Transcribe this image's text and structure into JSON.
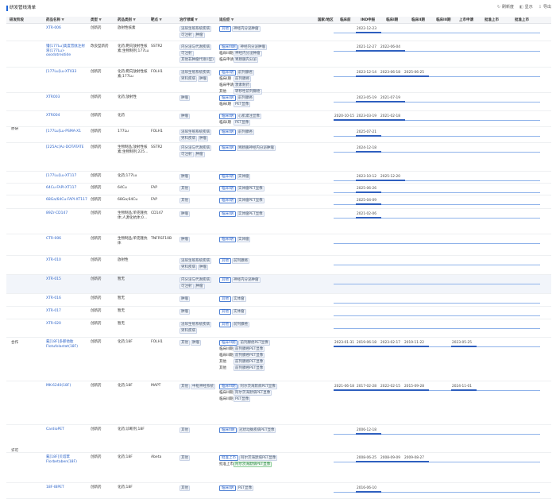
{
  "header": {
    "title": "研发管线清单",
    "tools": [
      {
        "icon": "reset-icon",
        "label": "刷新度"
      },
      {
        "icon": "display-icon",
        "label": "显示"
      },
      {
        "icon": "export-icon",
        "label": "导出"
      }
    ]
  },
  "columns": [
    "研发阶段",
    "药品名称",
    "类型",
    "药品类别",
    "靶点",
    "治疗领域",
    "适应症",
    "国家/地区",
    "临床前",
    "IND申报",
    "临床I期",
    "临床II期",
    "临床III期",
    "上市申请",
    "批准上市",
    "批准上市"
  ],
  "groups": [
    "原研",
    "合作",
    "许可"
  ],
  "rows": [
    {
      "name": "XTR-006",
      "type": "创新药",
      "cat": "放射性核素",
      "target": "",
      "areas": [
        "泌尿生殖系统疾病",
        "可注射",
        "肿瘤"
      ],
      "stage": "其他",
      "ind": "神经内分泌肿瘤",
      "dates": {
        "d1": "2022-12-23"
      }
    },
    {
      "name": "镥[177Lu]奥度普肽注射液(177Lu)-oxodotreotide",
      "type": "改良型新药",
      "cat": "化药;靶向放射性核素;生物制剂;177Lu",
      "target": "SSTR2",
      "areas": [
        "内分泌与代谢疾病",
        "可注射",
        "其他非肿瘤代谢(I型)"
      ],
      "stages": [
        "临床III期",
        "临床III期",
        "临床申请"
      ],
      "inds": [
        "神经内分泌肿瘤",
        "神经内分泌肿瘤",
        "胃肠胰内分泌"
      ],
      "dates": {
        "d1": "2021-12-27",
        "d2": "2022-06-04"
      }
    },
    {
      "name": "[177Lu]Lu-XT033",
      "type": "创新药",
      "cat": "化药;靶向放射性核素;177Lu",
      "target": "FOLH1",
      "areas": [
        "泌尿生殖系统疾病",
        "男科疾病",
        "肿瘤"
      ],
      "stages": [
        "临床I期",
        "临床I期",
        "临床申请",
        "其他"
      ],
      "inds": [
        "前列腺癌",
        "前列腺癌",
        "激素耐药",
        "转移性前列腺癌"
      ],
      "dates": {
        "d1": "2023-12-14",
        "d2": "2023-06-18",
        "d3": "2025-06-25"
      }
    },
    {
      "name": "XTR003",
      "type": "创新药",
      "cat": "化药;放射性",
      "target": "",
      "areas": [
        "肿瘤"
      ],
      "stages": [
        "临床I期",
        "临床I期"
      ],
      "inds": [
        "前列腺癌",
        "PET显像"
      ],
      "dates": {
        "d1": "2023-05-19",
        "d2": "2021-07-19"
      }
    },
    {
      "name": "XTR004",
      "type": "创新药",
      "cat": "化药",
      "target": "",
      "areas": [
        "肿瘤"
      ],
      "stages": [
        "临床I期",
        "临床I期"
      ],
      "inds": [
        "心肌灌注显像",
        "PET显像"
      ],
      "dates": {
        "d0": "2020-10-15",
        "d1": "2023-03-19",
        "d2": "2021-02-18"
      }
    },
    {
      "name": "[177Lu]Lu-PSMA-X1",
      "type": "创新药",
      "cat": "177Lu",
      "target": "FOLH1",
      "areas": [
        "泌尿生殖系统疾病",
        "男科疾病",
        "肿瘤"
      ],
      "stages": [
        "临床I期"
      ],
      "inds": [
        "前列腺癌"
      ],
      "dates": {
        "d1": "2025-07-21"
      }
    },
    {
      "name": "[225Ac]Ac-DOTATATE",
      "type": "创新药",
      "cat": "生物制品;放射性核素;生物制剂;225...",
      "target": "SSTR2",
      "areas": [
        "内分泌与代谢疾病",
        "可注射",
        "肿瘤"
      ],
      "stages": [
        "临床I期"
      ],
      "inds": [
        "胃肠胰神经内分泌肿瘤"
      ],
      "dates": {
        "d1": "2024-12-18"
      }
    },
    {
      "name": "[177Lu]Lu-XT117",
      "type": "创新药",
      "cat": "化药;177Lu",
      "target": "",
      "areas": [
        "肿瘤"
      ],
      "stages": [
        "临床I期"
      ],
      "inds": [
        "实体瘤"
      ],
      "dates": {
        "d1": "2023-10-12",
        "d2": "2025-12-20"
      }
    },
    {
      "name": "64Cu-FAPI-XT117",
      "type": "创新药",
      "cat": "64Cu",
      "target": "FAP",
      "areas": [
        "其他"
      ],
      "stages": [
        "临床I期"
      ],
      "inds": [
        "实体瘤PET显像"
      ],
      "dates": {
        "d1": "2025-06-26"
      }
    },
    {
      "name": "68Ga/64Cu-FAPI-XT117",
      "type": "创新药",
      "cat": "68Ga;64Cu",
      "target": "FAP",
      "areas": [
        "其他"
      ],
      "stages": [
        "临床I期"
      ],
      "inds": [
        "实体瘤PET显像"
      ],
      "dates": {
        "d1": "2025-04-09"
      }
    },
    {
      "name": "89Zr-CD147",
      "type": "创新药",
      "cat": "生物制品;单克隆抗体;人源化抗体;0...",
      "target": "CD147",
      "areas": [
        "肿瘤"
      ],
      "stages": [
        "临床I期"
      ],
      "inds": [
        "实体瘤PET显像"
      ],
      "dates": {
        "d1": "2021-02-06"
      }
    },
    {
      "name": "CTR-006",
      "type": "创新药",
      "cat": "生物制品;单克隆抗体",
      "target": "TNFRSF10B",
      "areas": [
        "肿瘤"
      ],
      "stages": [
        "临床I期"
      ],
      "inds": [
        "实体瘤"
      ],
      "dates": {}
    },
    {
      "name": "XTR-010",
      "type": "创新药",
      "cat": "放射性",
      "target": "",
      "areas": [
        "泌尿生殖系统疾病",
        "男科疾病",
        "肿瘤"
      ],
      "stage": "其他",
      "ind": "前列腺癌",
      "dates": {}
    },
    {
      "name": "XTR-015",
      "type": "创新药",
      "cat": "暂无",
      "target": "",
      "areas": [
        "内分泌与代谢疾病",
        "可注射",
        "肿瘤"
      ],
      "stage": "其他",
      "ind": "神经内分泌肿瘤",
      "dates": {},
      "sel": true
    },
    {
      "name": "XTR-016",
      "type": "创新药",
      "cat": "暂无",
      "target": "",
      "areas": [
        "肿瘤"
      ],
      "stage": "其他",
      "ind": "实体瘤",
      "dates": {}
    },
    {
      "name": "XTR-017",
      "type": "创新药",
      "cat": "暂无",
      "target": "",
      "areas": [
        "肿瘤"
      ],
      "stage": "其他",
      "ind": "实体瘤",
      "dates": {}
    },
    {
      "name": "XTR-020",
      "type": "创新药",
      "cat": "暂无",
      "target": "",
      "areas": [
        "泌尿生殖系统疾病",
        "男科疾病"
      ],
      "stage": "其他",
      "ind": "前列腺癌",
      "dates": {}
    },
    {
      "name": "氟[18F]多那他肽 Flotufolastat(18F)",
      "type": "创新药",
      "cat": "化药;18F",
      "target": "FOLH1",
      "areas": [
        "其他",
        "肿瘤"
      ],
      "stages": [
        "临床III期",
        "临床III期",
        "临床III期",
        "其他",
        "其他"
      ],
      "inds": [
        "前列腺癌PET显像",
        "前列腺癌PET显像",
        "前列腺癌PET显像",
        "前列腺癌PET显像",
        "前列腺癌PET显像"
      ],
      "dates": {
        "d0": "2023-01-31",
        "d1": "2019-06-18",
        "d2": "2023-02-17",
        "d3": "2019-11-22",
        "d4": "2023-05-25"
      }
    },
    {
      "name": "MK-6240(18F)",
      "type": "创新药",
      "cat": "化药;18F",
      "target": "MAPT",
      "areas": [
        "其他",
        "中枢神经系统"
      ],
      "stages": [
        "临床III期",
        "临床III期",
        "临床III期"
      ],
      "inds": [
        "阿尔茨海默病PET显像",
        "阿尔茨海默病PET显像",
        "PET显像"
      ],
      "dates": {
        "d0": "2021-06-18",
        "d1": "2017-02-28",
        "d2": "2022-02-15",
        "d3": "2015-09-28",
        "d4": "2024-11-01"
      }
    },
    {
      "name": "CardioPET",
      "type": "创新药",
      "cat": "化药;诊断剂;18F",
      "target": "",
      "areas": [
        "其他"
      ],
      "stages": [
        "临床II期"
      ],
      "inds": [
        "冠状动脉疾病PET显像"
      ],
      "dates": {
        "d1": "2006-12-18"
      }
    },
    {
      "name": "氟[18F]贝塔苯 Florbetaben(18F)",
      "type": "创新药",
      "cat": "化药;18F",
      "target": "Abeta",
      "areas": [
        "其他"
      ],
      "stages": [
        "批准上市",
        "批准上市"
      ],
      "inds": [
        "阿尔茨海默病PET显像",
        "阿尔茨海默病PET显像"
      ],
      "dates": {
        "d1": "2008-06-25",
        "d2": "2008-09-09",
        "d3": "2009-08-27"
      }
    },
    {
      "name": "18F-IBPET",
      "type": "创新药",
      "cat": "化药;18F",
      "target": "",
      "areas": [
        "其他"
      ],
      "stages": [
        "临床I期"
      ],
      "inds": [
        "PET显像"
      ],
      "dates": {
        "d1": "2016-06-10"
      }
    }
  ]
}
